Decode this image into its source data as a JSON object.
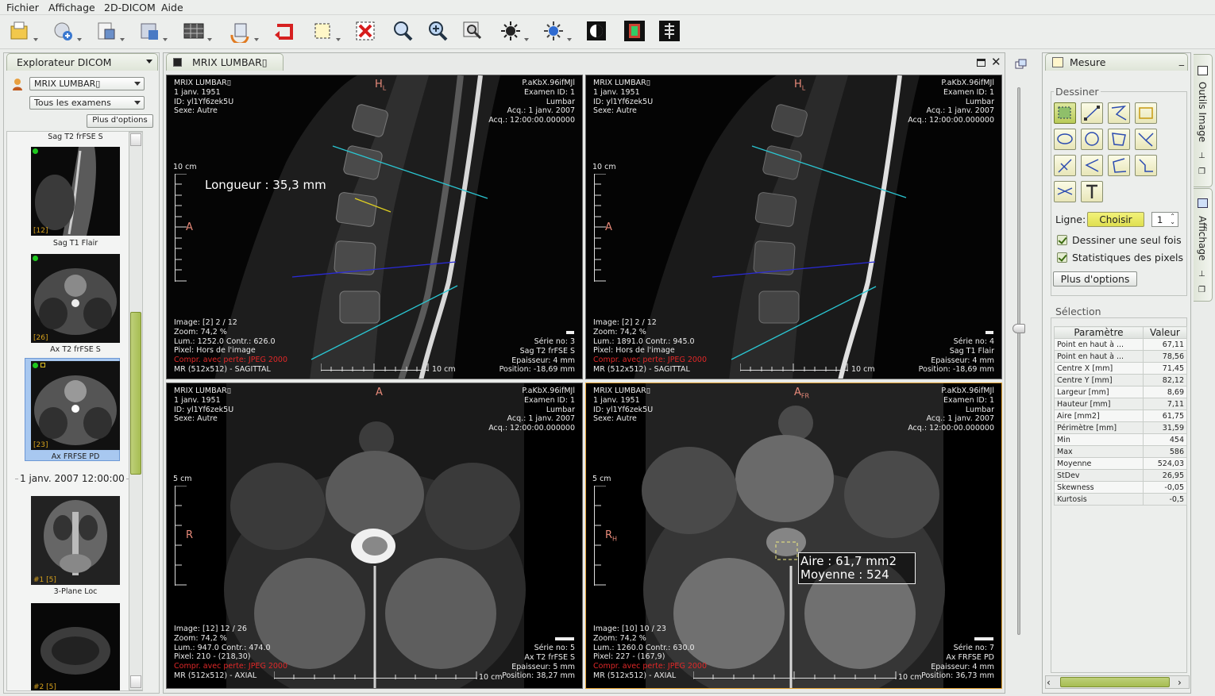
{
  "menu": [
    "Fichier",
    "Affichage",
    "2D-DICOM",
    "Aide"
  ],
  "explorer": {
    "title": "Explorateur DICOM",
    "patient_combo": "MRIX LUMBAR▯",
    "exam_combo": "Tous les examens",
    "more_options": "Plus d'options",
    "top_series_label": "Sag T2 frFSE S",
    "date_group": "1 janv. 2007 12:00:00",
    "thumbs": [
      {
        "label": "Sag T1 Flair",
        "num": "[12]"
      },
      {
        "label": "Ax T2 frFSE S",
        "num": "[26]"
      },
      {
        "label": "Ax FRFSE PD",
        "num": "[23]"
      },
      {
        "label": "3-Plane Loc",
        "num": "#1 [5]"
      },
      {
        "label": "",
        "num": "#2 [5]"
      }
    ]
  },
  "viewer": {
    "tab_title": "MRIX LUMBAR▯",
    "viewports": [
      {
        "tl": "MRIX LUMBAR▯\n1 janv. 1951\nID: yl1Yf6zek5U\nSexe: Autre",
        "tr": "P.aKbX.96ifMJl\nExamen ID: 1\nLumbar\nAcq.: 1 janv. 2007\nAcq.: 12:00:00.000000",
        "bl": "Image: [2] 2 / 12\nZoom: 74,2 %\nLum.: 1252.0 Contr.: 626.0\nPixel: Hors de l'image",
        "bl_red": "Compr. avec perte: JPEG 2000",
        "bl_last": "MR (512x512) - SAGITTAL",
        "br": "Série no: 3\nSag T2 frFSE S\nEpaisseur: 4 mm\nPosition: -18,69 mm",
        "orient_top": "H",
        "orient_top_sub": "L",
        "orient_left": "A",
        "scale": "10 cm",
        "hscale": "10 cm",
        "measure": "Longueur : 35,3 mm"
      },
      {
        "tl": "MRIX LUMBAR▯\n1 janv. 1951\nID: yl1Yf6zek5U\nSexe: Autre",
        "tr": "P.aKbX.96ifMJl\nExamen ID: 1\nLumbar\nAcq.: 1 janv. 2007\nAcq.: 12:00:00.000000",
        "bl": "Image: [2] 2 / 12\nZoom: 74,2 %\nLum.: 1891.0 Contr.: 945.0\nPixel: Hors de l'image",
        "bl_red": "Compr. avec perte: JPEG 2000",
        "bl_last": "MR (512x512) - SAGITTAL",
        "br": "Série no: 4\nSag T1 Flair\nEpaisseur: 4 mm\nPosition: -18,69 mm",
        "orient_top": "H",
        "orient_top_sub": "L",
        "orient_left": "A",
        "scale": "10 cm",
        "hscale": "10 cm"
      },
      {
        "tl": "MRIX LUMBAR▯\n1 janv. 1951\nID: yl1Yf6zek5U\nSexe: Autre",
        "tr": "P.aKbX.96ifMJl\nExamen ID: 1\nLumbar\nAcq.: 1 janv. 2007\nAcq.: 12:00:00.000000",
        "bl": "Image: [12] 12 / 26\nZoom: 74,2 %\nLum.: 947.0 Contr.: 474.0\nPixel: 210 - (218,30)",
        "bl_red": "Compr. avec perte: JPEG 2000",
        "bl_last": "MR (512x512) - AXIAL",
        "br": "Série no: 5\nAx T2 frFSE S\nEpaisseur: 5 mm\nPosition: 38,27 mm",
        "orient_top": "A",
        "orient_top_sub": "",
        "orient_left": "R",
        "orient_left_sub": "",
        "scale": "5 cm",
        "hscale": "10 cm"
      },
      {
        "tl": "MRIX LUMBAR▯\n1 janv. 1951\nID: yl1Yf6zek5U\nSexe: Autre",
        "tr": "P.aKbX.96ifMJl\nExamen ID: 1\nLumbar\nAcq.: 1 janv. 2007\nAcq.: 12:00:00.000000",
        "bl": "Image: [10] 10 / 23\nZoom: 74,2 %\nLum.: 1260.0 Contr.: 630.0\nPixel: 227 - (167,9)",
        "bl_red": "Compr. avec perte: JPEG 2000",
        "bl_last": "MR (512x512) - AXIAL",
        "br": "Série no: 7\nAx FRFSE PD\nEpaisseur: 4 mm\nPosition: 36,73 mm",
        "orient_top": "A",
        "orient_top_sub": "FR",
        "orient_left": "R",
        "orient_left_sub": "H",
        "scale": "5 cm",
        "hscale": "10 cm",
        "roi_line1": "Aire : 61,7 mm2",
        "roi_line2": "Moyenne : 524"
      }
    ]
  },
  "measure": {
    "title": "Mesure",
    "draw_group": "Dessiner",
    "line_label": "Ligne:",
    "choose_button": "Choisir",
    "line_width": "1",
    "draw_once": "Dessiner une seul fois",
    "pixel_stats": "Statistiques des pixels",
    "more_options": "Plus d'options",
    "selection_group": "Sélection",
    "table_headers": [
      "Paramètre",
      "Valeur"
    ],
    "rows": [
      [
        "Point en haut à ...",
        "67,11"
      ],
      [
        "Point en haut à ...",
        "78,56"
      ],
      [
        "Centre X [mm]",
        "71,45"
      ],
      [
        "Centre Y [mm]",
        "82,12"
      ],
      [
        "Largeur [mm]",
        "8,69"
      ],
      [
        "Hauteur [mm]",
        "7,11"
      ],
      [
        "Aire [mm2]",
        "61,75"
      ],
      [
        "Périmètre [mm]",
        "31,59"
      ],
      [
        "Min",
        "454"
      ],
      [
        "Max",
        "586"
      ],
      [
        "Moyenne",
        "524,03"
      ],
      [
        "StDev",
        "26,95"
      ],
      [
        "Skewness",
        "-0,05"
      ],
      [
        "Kurtosis",
        "-0,5"
      ]
    ]
  },
  "side_tabs": [
    "Outils Image",
    "Affichage"
  ],
  "colors": {
    "accent": "#c9da6b",
    "selection": "#a8c8f0",
    "viewport_active": "#e0a030",
    "overlay_red": "#e02828"
  }
}
